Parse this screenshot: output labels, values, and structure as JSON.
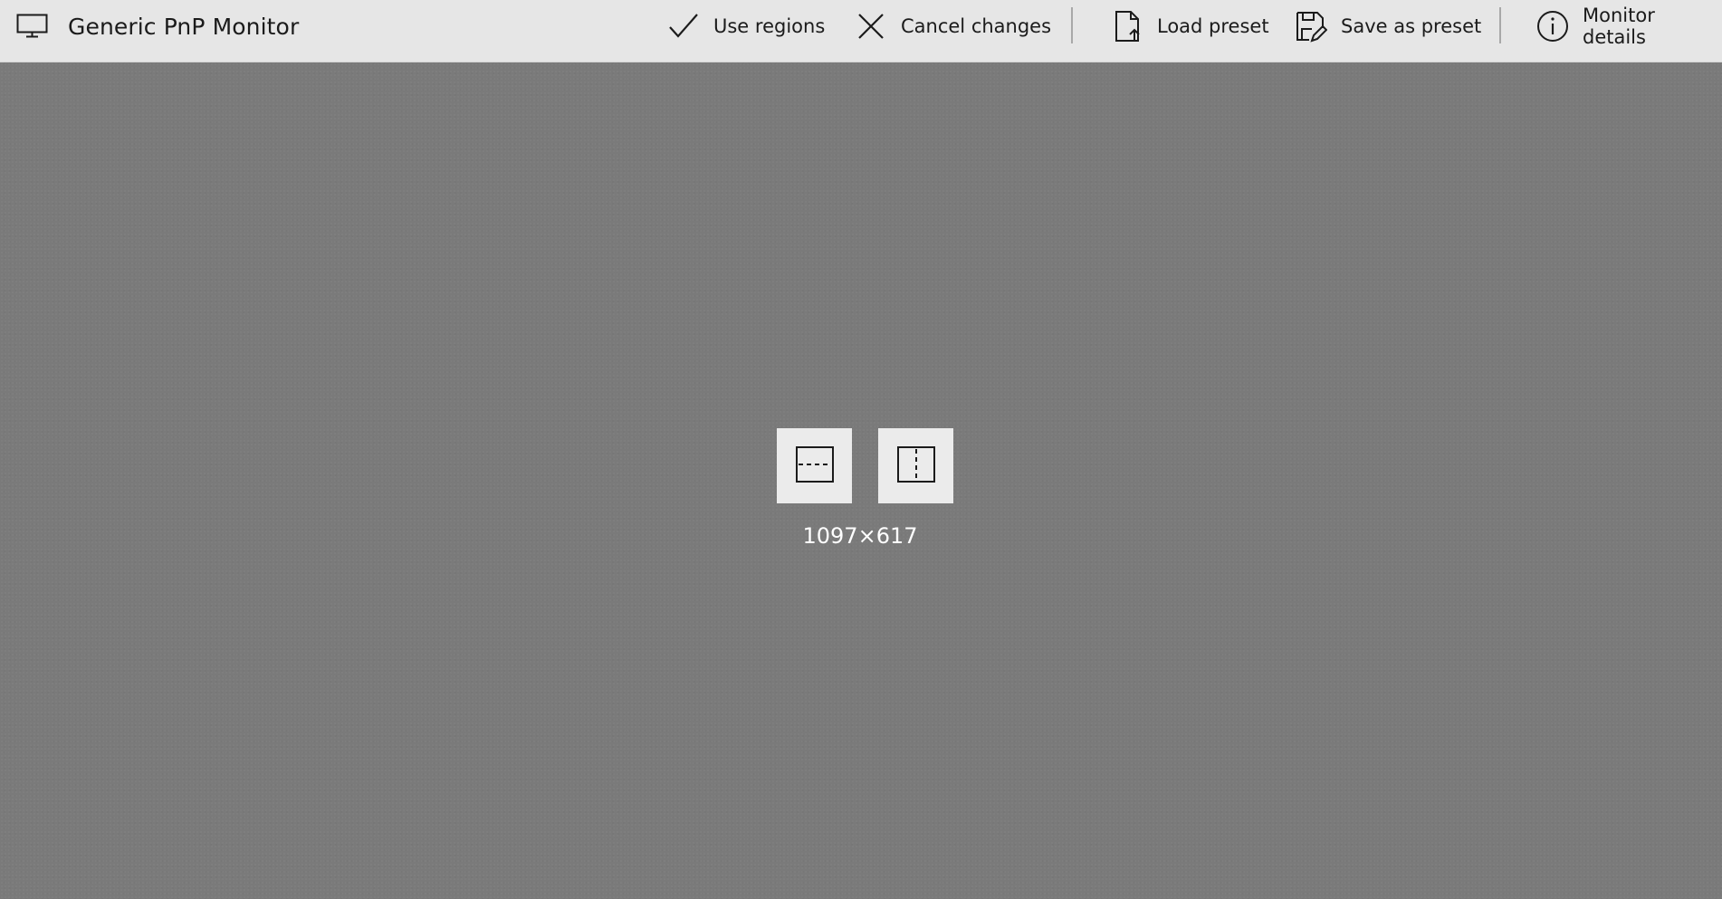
{
  "window": {
    "title": "Generic PnP Monitor",
    "icon": "monitor-icon"
  },
  "toolbar": {
    "use_regions": {
      "label": "Use regions",
      "icon": "checkmark-icon"
    },
    "cancel_changes": {
      "label": "Cancel changes",
      "icon": "close-icon"
    },
    "load_preset": {
      "label": "Load preset",
      "icon": "file-upload-icon"
    },
    "save_as_preset": {
      "label": "Save as preset",
      "icon": "save-edit-icon"
    },
    "monitor_details": {
      "label": "Monitor details",
      "icon": "info-icon"
    }
  },
  "zone": {
    "split_horizontal_icon": "split-horizontal-icon",
    "split_vertical_icon": "split-vertical-icon",
    "dimensions": "1097×617"
  },
  "colors": {
    "toolbar_bg": "#e6e6e6",
    "canvas_bg": "#7a7a7a",
    "button_bg": "#ebebeb",
    "text_dark": "#1b1b1b",
    "text_light": "#ffffff"
  }
}
